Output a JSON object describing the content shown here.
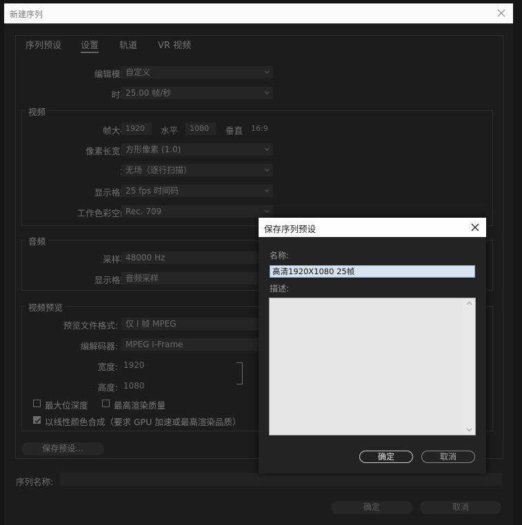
{
  "window": {
    "title": "新建序列"
  },
  "tabs": [
    {
      "label": "序列预设"
    },
    {
      "label": "设置"
    },
    {
      "label": "轨道"
    },
    {
      "label": "VR 视频"
    }
  ],
  "settings": {
    "edit_mode_label": "编辑模式:",
    "edit_mode_value": "自定义",
    "timebase_label": "时基:",
    "timebase_value": "25.00  帧/秒"
  },
  "video": {
    "group_title": "视频",
    "frame_size_label": "帧大小:",
    "frame_width": "1920",
    "horizontal_label": "水平",
    "frame_height": "1080",
    "vertical_label": "垂直",
    "aspect": "16:9",
    "pixel_aspect_label": "像素长宽比:",
    "pixel_aspect_value": "方形像素 (1.0)",
    "field_label": "场:",
    "field_value": "无场（逐行扫描）",
    "display_format_label": "显示格式:",
    "display_format_value": "25 fps 时间码",
    "color_space_label": "工作色彩空间:",
    "color_space_value": "Rec. 709"
  },
  "audio": {
    "group_title": "音频",
    "sample_rate_label": "采样率:",
    "sample_rate_value": "48000 Hz",
    "display_format_label": "显示格式:",
    "display_format_value": "音频采样"
  },
  "preview": {
    "group_title": "视频预览",
    "file_format_label": "预览文件格式:",
    "file_format_value": "仅 I 帧 MPEG",
    "codec_label": "编解码器:",
    "codec_value": "MPEG I-Frame",
    "width_label": "宽度:",
    "width_value": "1920",
    "height_label": "高度:",
    "height_value": "1080"
  },
  "options": {
    "max_bit_depth": "最大位深度",
    "max_render_quality": "最高渲染质量",
    "linear_color": "以线性颜色合成（要求 GPU 加速或最高渲染品质）"
  },
  "save_preset_button": "保存预设...",
  "sequence_name_label": "序列名称:",
  "main_ok": "确定",
  "main_cancel": "取消",
  "modal": {
    "title": "保存序列预设",
    "name_label": "名称:",
    "name_value": "高清1920X1080 25帧",
    "desc_label": "描述:",
    "ok": "确定",
    "cancel": "取消"
  },
  "colors": {
    "modal_accent": "#8fb2d0",
    "titlebar": "#fbfbfb",
    "background": "#1c1c1c"
  },
  "icons": [
    "close-icon",
    "chevron-down-icon",
    "checkmark-icon",
    "scroll-up-icon",
    "scroll-down-icon"
  ]
}
